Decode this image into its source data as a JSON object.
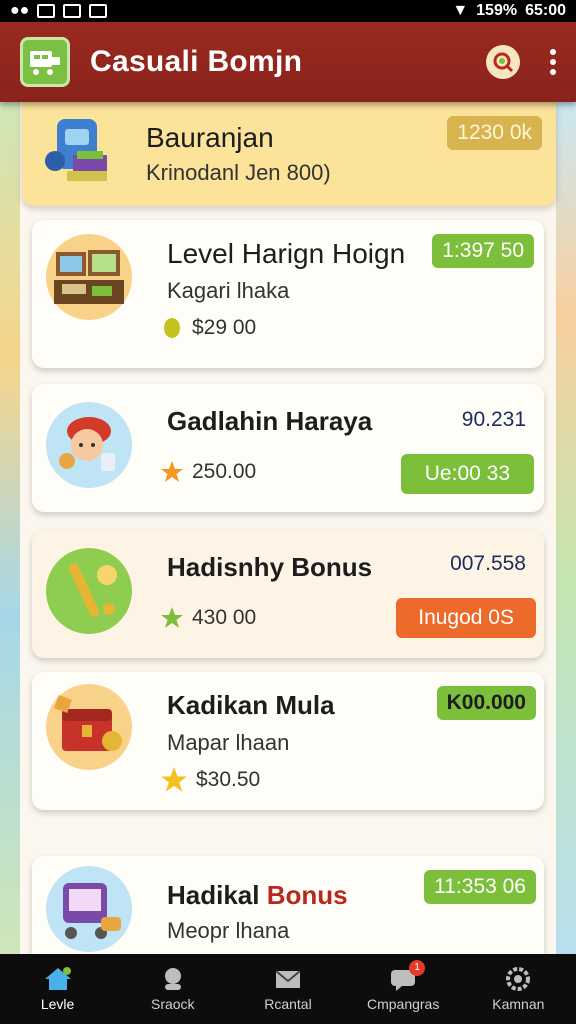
{
  "status_bar": {
    "left_icons": [
      "notification-icon",
      "image-icon",
      "image-icon",
      "image-icon"
    ],
    "battery": "159%",
    "time": "65:00"
  },
  "app_bar": {
    "title": "Casuali Bomjn"
  },
  "cards": [
    {
      "title": "Bauranjan",
      "subtitle": "Krinodanl Jen 800)",
      "badge": "1230 0k",
      "badge_style": "tan"
    },
    {
      "title": "Level Harign Hoign",
      "subtitle": "Kagari lhaka",
      "price": "$29 00",
      "badge": "1:397 50",
      "badge_style": "green"
    },
    {
      "title": "Gadlahin Haraya",
      "price": "250.00",
      "number": "90.231",
      "badge": "Ue:00 33",
      "badge_style": "green"
    },
    {
      "title": "Hadisnhy Bonus",
      "price": "430 00",
      "number": "007.558",
      "badge": "Inugod 0S",
      "badge_style": "orange"
    },
    {
      "title": "Kadikan Mula",
      "subtitle": "Mapar lhaan",
      "price": "$30.50",
      "badge": "K00.000",
      "badge_style": "green"
    },
    {
      "title_a": "Hadikal",
      "title_b": "Bonus",
      "subtitle": "Meopr lhana",
      "badge": "11:353 06",
      "badge_style": "green"
    }
  ],
  "bottom_nav": [
    {
      "label": "Levle",
      "icon": "home-icon",
      "active": true
    },
    {
      "label": "Sraock",
      "icon": "character-icon",
      "active": false
    },
    {
      "label": "Rcantal",
      "icon": "mail-icon",
      "active": false
    },
    {
      "label": "Cmpangras",
      "icon": "chat-icon",
      "active": false,
      "badge": "1"
    },
    {
      "label": "Kamnan",
      "icon": "gear-icon",
      "active": false
    }
  ],
  "colors": {
    "app_bar": "#8a231b",
    "accent_green": "#7cbf3a",
    "accent_orange": "#ec6a2a",
    "featured_card": "#fbe39a"
  }
}
